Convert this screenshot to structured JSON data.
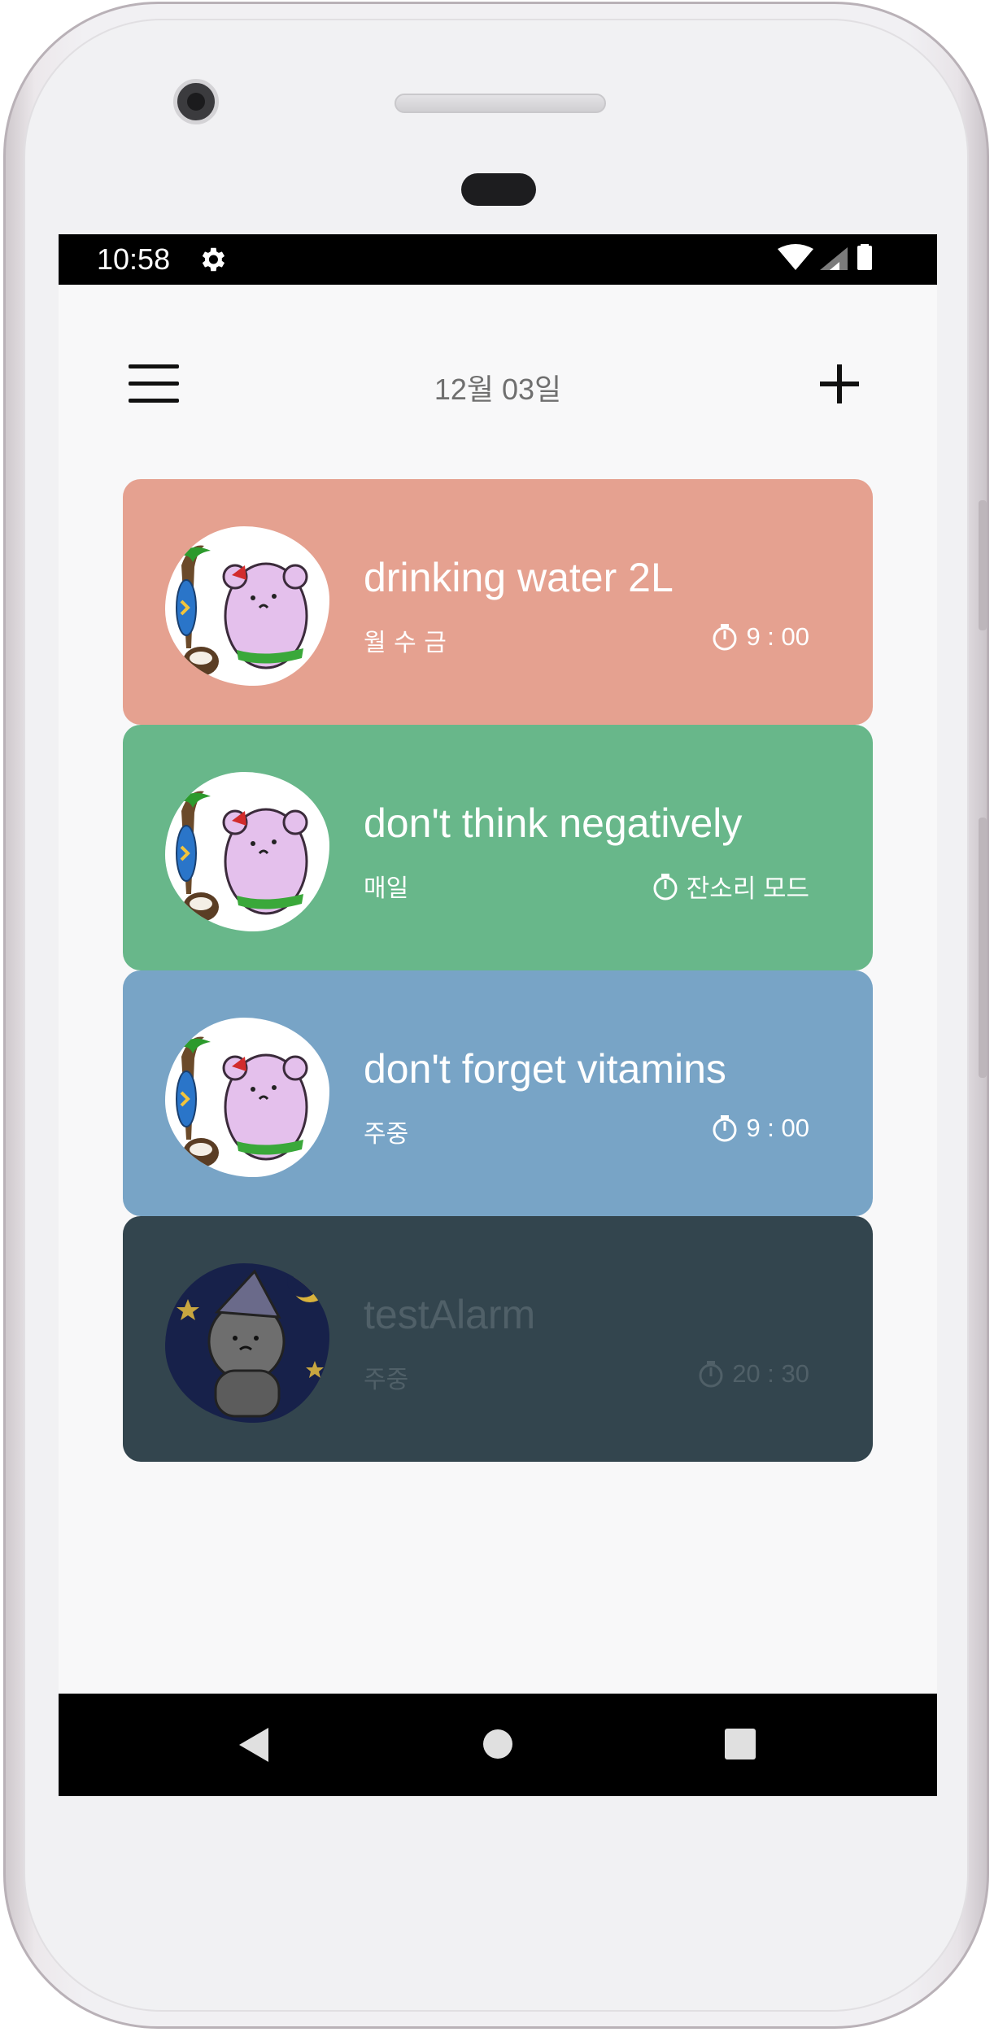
{
  "status_bar": {
    "time": "10:58"
  },
  "header": {
    "date": "12월 03일"
  },
  "alarms": [
    {
      "title": "drinking water 2L",
      "days": "월 수 금",
      "time": "9 : 00",
      "color": "#e5a190",
      "active": true,
      "image": "bear-hula-icon"
    },
    {
      "title": "don't think negatively",
      "days": "매일",
      "time": "잔소리 모드",
      "color": "#68b78a",
      "active": true,
      "image": "bear-hula-icon"
    },
    {
      "title": "don't forget vitamins",
      "days": "주중",
      "time": "9 : 00",
      "color": "#78a4c6",
      "active": true,
      "image": "bear-hula-icon"
    },
    {
      "title": "testAlarm",
      "days": "주중",
      "time": "20 : 30",
      "color": "#33454e",
      "active": false,
      "image": "bear-sleep-icon"
    }
  ]
}
